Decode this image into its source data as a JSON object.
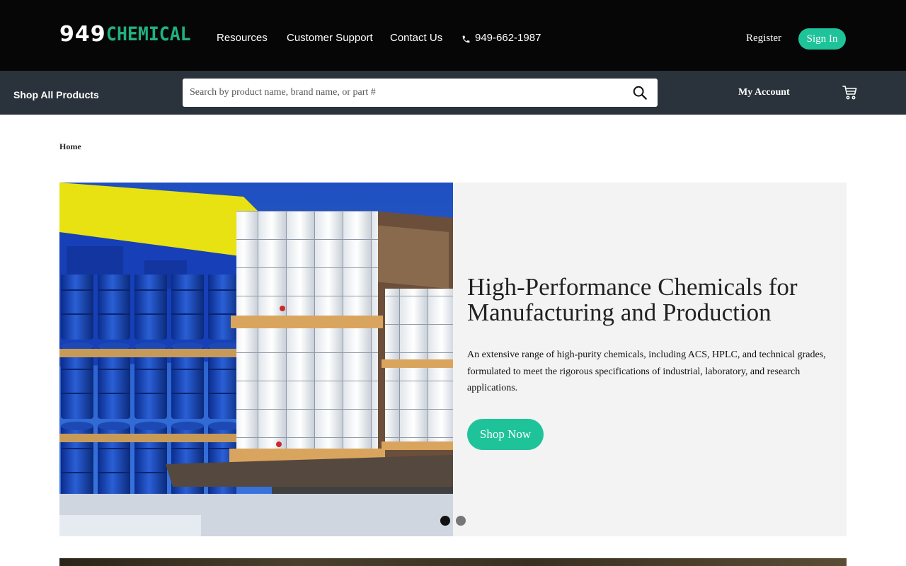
{
  "header": {
    "logo_number": "949",
    "logo_word": "CHEMICAL",
    "nav": {
      "resources": "Resources",
      "customer_support": "Customer Support",
      "contact_us": "Contact Us"
    },
    "phone": "949-662-1987",
    "register": "Register",
    "sign_in": "Sign In"
  },
  "subbar": {
    "shop_all": "Shop All Products",
    "search_placeholder": "Search by product name, brand name, or part #",
    "my_account": "My Account"
  },
  "breadcrumb": {
    "home": "Home"
  },
  "hero": {
    "title": "High-Performance Chemicals for Manufacturing and Production",
    "description": "An extensive range of high-purity chemicals, including ACS, HPLC, and technical grades, formulated to meet the rigorous specifications of industrial, laboratory, and research applications.",
    "cta": "Shop Now",
    "slides": {
      "count": 2,
      "active": 1
    }
  },
  "colors": {
    "accent": "#1fc39a",
    "logo_green": "#21b07e",
    "topbar": "#060606",
    "subbar": "#2a333b",
    "hero_bg": "#f3f3f3"
  }
}
